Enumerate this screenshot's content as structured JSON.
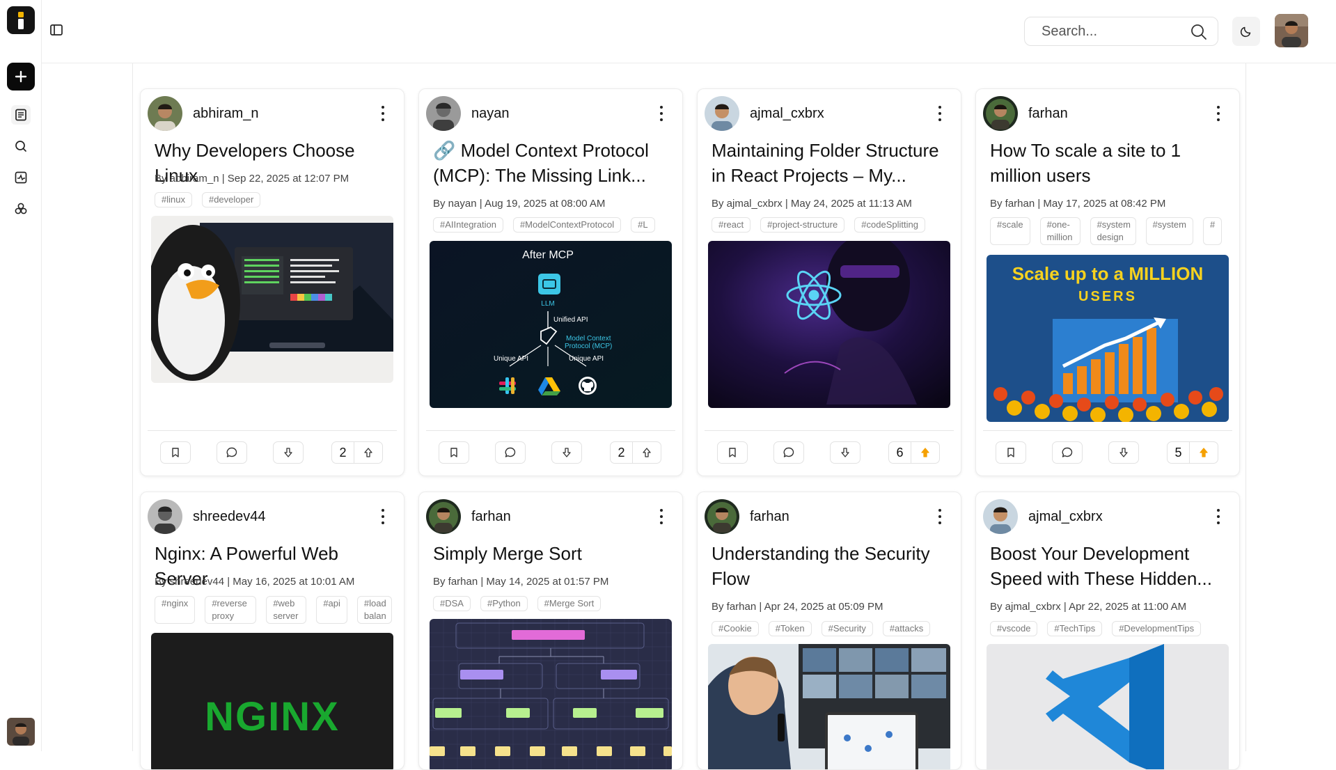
{
  "search": {
    "placeholder": "Search..."
  },
  "posts": [
    {
      "author": "abhiram_n",
      "title": "Why Developers Choose Linux",
      "meta": "By abhiram_n | Sep 22, 2025 at 12:07 PM",
      "tags": [
        "#linux",
        "#developer"
      ],
      "votes": "2",
      "upvoted": false
    },
    {
      "author": "nayan",
      "title": "🔗 Model Context Protocol (MCP): The Missing Link...",
      "meta": "By nayan | Aug 19, 2025 at 08:00 AM",
      "tags": [
        "#AIIntegration",
        "#ModelContextProtocol",
        "#L"
      ],
      "votes": "2",
      "upvoted": false,
      "image_text": {
        "heading": "After MCP",
        "llm": "LLM",
        "unified": "Unified API",
        "mcp_line1": "Model Context",
        "mcp_line2": "Protocol (MCP)",
        "unique_left": "Unique API",
        "unique_right": "Unique API"
      }
    },
    {
      "author": "ajmal_cxbrx",
      "title": "Maintaining Folder Structure in React Projects – My...",
      "meta": "By ajmal_cxbrx | May 24, 2025 at 11:13 AM",
      "tags": [
        "#react",
        "#project-structure",
        "#codeSplitting"
      ],
      "votes": "6",
      "upvoted": true
    },
    {
      "author": "farhan",
      "title": "How To scale a site to 1 million users",
      "meta": "By farhan | May 17, 2025 at 08:42 PM",
      "tags": [
        "#scale",
        "#one-million",
        "#system design",
        "#system",
        "#"
      ],
      "votes": "5",
      "upvoted": true,
      "image_text": {
        "line1": "Scale up to a MILLION",
        "line2": "USERS"
      }
    },
    {
      "author": "shreedev44",
      "title": "Nginx: A Powerful Web Server",
      "meta": "By shreedev44 | May 16, 2025 at 10:01 AM",
      "tags": [
        "#nginx",
        "#reverse proxy",
        "#web server",
        "#api",
        "#load balan"
      ],
      "image_text": {
        "logo": "NGINX"
      }
    },
    {
      "author": "farhan",
      "title": "Simply Merge Sort",
      "meta": "By farhan | May 14, 2025 at 01:57 PM",
      "tags": [
        "#DSA",
        "#Python",
        "#Merge Sort"
      ]
    },
    {
      "author": "farhan",
      "title": "Understanding the Security Flow",
      "meta": "By farhan | Apr 24, 2025 at 05:09 PM",
      "tags": [
        "#Cookie",
        "#Token",
        "#Security",
        "#attacks"
      ]
    },
    {
      "author": "ajmal_cxbrx",
      "title": "Boost Your Development Speed with These Hidden...",
      "meta": "By ajmal_cxbrx | Apr 22, 2025 at 11:00 AM",
      "tags": [
        "#vscode",
        "#TechTips",
        "#DevelopmentTips"
      ]
    }
  ],
  "colors": {
    "accent_upvote": "#f5a000",
    "sidebar_dark": "#0a0a0a"
  },
  "icons": [
    "logo-icon",
    "plus-icon",
    "sidebar-toggle-icon",
    "feed-icon",
    "search-icon",
    "analytics-icon",
    "community-icon",
    "moon-icon",
    "bookmark-icon",
    "comment-icon",
    "downvote-icon",
    "upvote-icon",
    "more-icon"
  ]
}
